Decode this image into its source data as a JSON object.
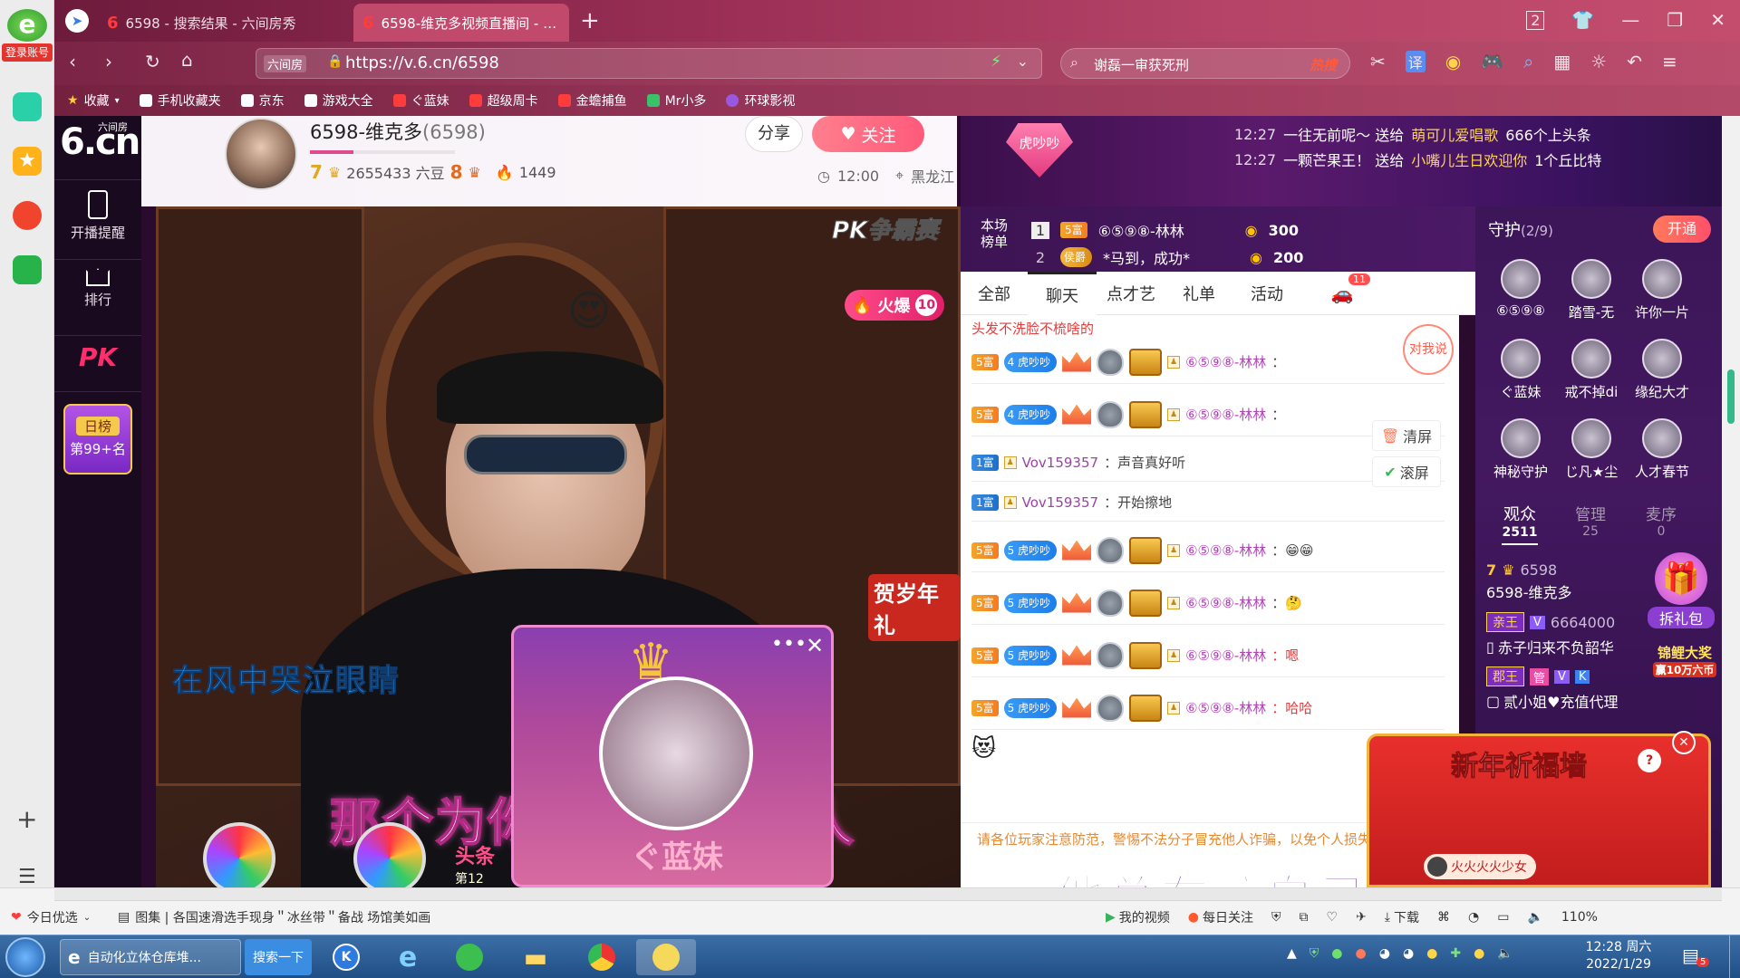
{
  "leftrail": {
    "login_label": "登录账号"
  },
  "tabs": [
    {
      "title": "6598 - 搜索结果 - 六间房秀"
    },
    {
      "title": "6598-维克多视频直播间 - 在线"
    }
  ],
  "address": {
    "url_prefix": "六间房",
    "url": "https://v.6.cn/6598",
    "search_text": "谢磊一审获死刑",
    "hot_label": "热搜"
  },
  "bookmarks": [
    "收藏",
    "手机收藏夹",
    "京东",
    "游戏大全",
    "ぐ蓝妹",
    "超级周卡",
    "金蟾捕鱼",
    "Mr小多",
    "环球影视"
  ],
  "sitenav": {
    "logo_text": "6.cn",
    "logo_small": "六间房",
    "items": [
      "开播提醒",
      "排行"
    ],
    "pk_label": "PK",
    "daily_rank_title": "日榜",
    "daily_rank_value": "第99+名"
  },
  "host": {
    "title": "6598-维克多",
    "room_id": "(6598)",
    "level_a": "7",
    "beans": "2655433 六豆",
    "level_b": "8",
    "fans": "1449",
    "share_label": "分享",
    "follow_label": "关注",
    "time": "12:00",
    "location": "黑龙江"
  },
  "video": {
    "pk_badge": "PK争霸赛",
    "fire_label": "火爆",
    "fire_count": "10",
    "overlay_lyric_1": "在风中哭泣眼睛",
    "overlay_lyric_2": "那个为你可以付出的人",
    "overlay_lyric_3": "他总在骗自己",
    "popup_name": "ぐ蓝妹",
    "newyear_badge": "贺岁年礼",
    "headline_label": "头条",
    "headline_rank": "第12"
  },
  "banner": {
    "badge": "虎吵吵",
    "messages": [
      {
        "time": "12:27",
        "text": "一往无前呢～ 送给",
        "target": "萌可儿爱唱歌",
        "tail": "666个上头条"
      },
      {
        "time": "12:27",
        "text": "一颗芒果王！ 送给",
        "target": "小嘴儿生日欢迎你",
        "tail": "1个丘比特"
      }
    ]
  },
  "rank": {
    "label": "本场榜单",
    "rows": [
      {
        "rank": "1",
        "badge": "5富",
        "name": "⑥⑤⑨⑧-林林",
        "score": "300"
      },
      {
        "rank": "2",
        "badge": "侯爵",
        "name": "*马到，成功*",
        "score": "200"
      }
    ]
  },
  "chat_tabs": [
    "全部",
    "聊天",
    "点才艺",
    "礼单",
    "活动"
  ],
  "chat_active_tab": "聊天",
  "car_badge": "11",
  "chat": {
    "top_line": "头发不洗脸不梳啥的",
    "messages": [
      {
        "fu": "5富",
        "hb": "4 虎吵吵",
        "user": "⑥⑤⑨⑧-林林",
        "text": "：",
        "style": "full"
      },
      {
        "fu": "5富",
        "hb": "4 虎吵吵",
        "user": "⑥⑤⑨⑧-林林",
        "text": "：",
        "style": "full"
      },
      {
        "fu": "1富",
        "hb": "",
        "user": "Vov159357",
        "text": "：声音真好听",
        "style": "short"
      },
      {
        "fu": "1富",
        "hb": "",
        "user": "Vov159357",
        "text": "：开始擦地",
        "style": "short"
      },
      {
        "fu": "5富",
        "hb": "5 虎吵吵",
        "user": "⑥⑤⑨⑧-林林",
        "text": "：😁😁",
        "style": "full"
      },
      {
        "fu": "5富",
        "hb": "5 虎吵吵",
        "user": "⑥⑤⑨⑧-林林",
        "text": "：🤔",
        "style": "full"
      },
      {
        "fu": "5富",
        "hb": "5 虎吵吵",
        "user": "⑥⑤⑨⑧-林林",
        "text": "：嗯",
        "style": "full"
      },
      {
        "fu": "5富",
        "hb": "5 虎吵吵",
        "user": "⑥⑤⑨⑧-林林",
        "text": "：哈哈",
        "style": "full"
      }
    ],
    "say_to_me": "对我说",
    "clear_label": "清屏",
    "scroll_label": "滚屏",
    "notice": "请各位玩家注意防范，警惕不法分子冒充他人诈骗，以免个人损失。"
  },
  "guard": {
    "title": "守护",
    "count": "(2/9)",
    "open_label": "开通",
    "members": [
      "⑥⑤⑨⑧",
      "踏雪-无",
      "许你一片",
      "ぐ蓝妹",
      "戒不掉di",
      "缘纪大才",
      "神秘守护",
      "じ凡★尘",
      "人才春节"
    ],
    "tabs": [
      {
        "label": "观众",
        "count": "2511"
      },
      {
        "label": "管理",
        "count": "25"
      },
      {
        "label": "麦序",
        "count": "0"
      }
    ],
    "viewers": [
      {
        "level": "7",
        "id": "6598",
        "name": "6598-维克多"
      },
      {
        "badge": "亲王",
        "vip": "V",
        "id": "6664000",
        "name": "赤子归来不负韶华"
      },
      {
        "badge": "郡王",
        "tags": [
          "管",
          "V",
          "K"
        ],
        "name": "贰小姐♥充值代理"
      }
    ],
    "gift_pack": "拆礼包",
    "koi_label": "锦鲤大奖",
    "koi_sub": "赢10万六币",
    "newyear_wall": "新年祈福墙",
    "fire_user": "火火火火少女"
  },
  "statusbar": {
    "today": "今日优选",
    "news": "图集 | 各国速滑选手现身＂冰丝带＂备战 场馆美如画",
    "items": [
      "我的视频",
      "每日关注",
      "下载"
    ],
    "zoom": "110%"
  },
  "taskbar": {
    "app1": "自动化立体仓库堆...",
    "app2": "搜索一下",
    "time": "12:28 周六",
    "date": "2022/1/29",
    "notif": "5"
  }
}
